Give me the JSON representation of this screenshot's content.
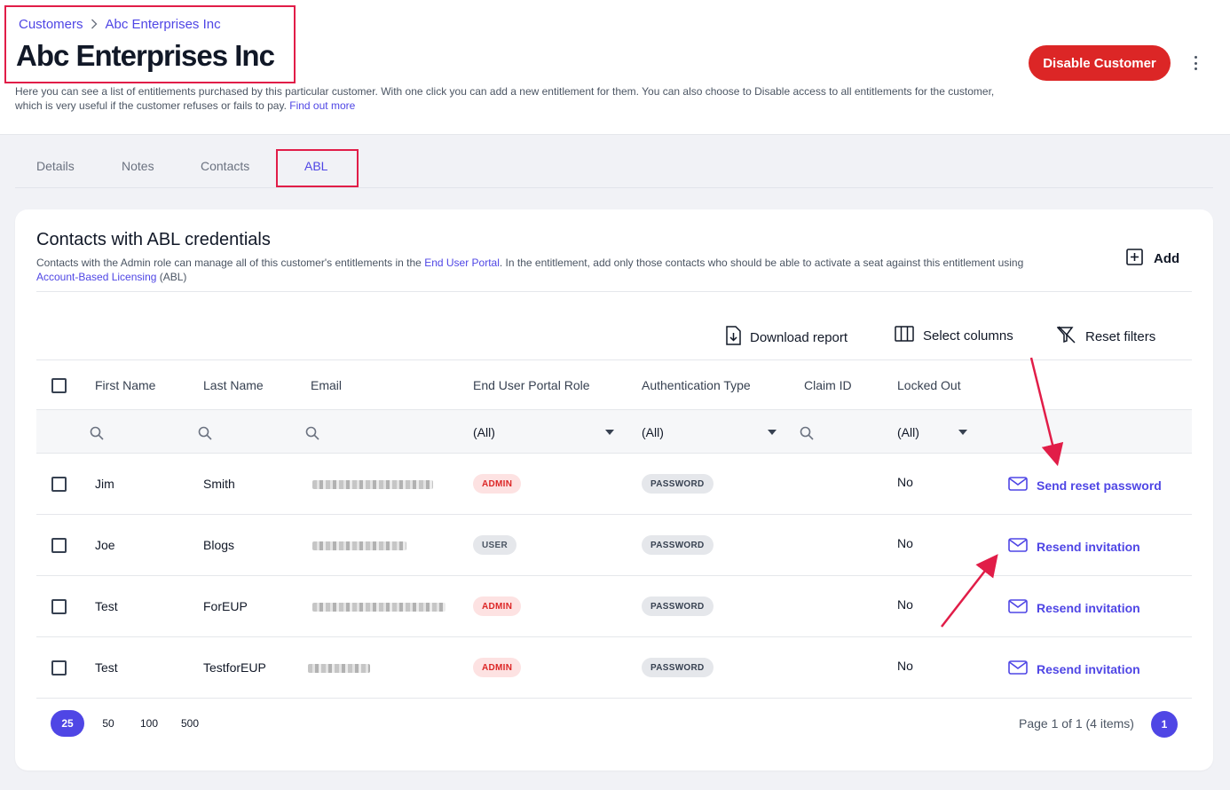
{
  "breadcrumb": {
    "parent": "Customers",
    "current": "Abc Enterprises Inc"
  },
  "page": {
    "title": "Abc Enterprises Inc",
    "description": "Here you can see a list of entitlements purchased by this particular customer. With one click you can add a new entitlement for them. You can also choose to Disable access to all entitlements for the customer, which is very useful if the customer refuses or fails to pay.",
    "find_out_more": "Find out more",
    "disable_button": "Disable Customer"
  },
  "tabs": [
    {
      "label": "Details"
    },
    {
      "label": "Notes"
    },
    {
      "label": "Contacts"
    },
    {
      "label": "ABL"
    }
  ],
  "card": {
    "title": "Contacts with ABL credentials",
    "desc_part1": "Contacts with the Admin role can manage all of this customer's entitlements in the ",
    "desc_link1": "End User Portal",
    "desc_part2": ". In the entitlement, add only those contacts who should be able to activate a seat against this entitlement using ",
    "desc_link2": "Account-Based Licensing",
    "desc_part3": " (ABL)",
    "add_label": "Add"
  },
  "toolbar": {
    "download": "Download report",
    "select_columns": "Select columns",
    "reset_filters": "Reset filters"
  },
  "table": {
    "headers": [
      "First Name",
      "Last Name",
      "Email",
      "End User Portal Role",
      "Authentication Type",
      "Claim ID",
      "Locked Out"
    ],
    "filters": {
      "role": "(All)",
      "auth": "(All)",
      "locked": "(All)"
    },
    "rows": [
      {
        "first": "Jim",
        "last": "Smith",
        "role": "ADMIN",
        "auth": "PASSWORD",
        "locked": "No",
        "action": "Send reset password"
      },
      {
        "first": "Joe",
        "last": "Blogs",
        "role": "USER",
        "auth": "PASSWORD",
        "locked": "No",
        "action": "Resend invitation"
      },
      {
        "first": "Test",
        "last": "ForEUP",
        "role": "ADMIN",
        "auth": "PASSWORD",
        "locked": "No",
        "action": "Resend invitation"
      },
      {
        "first": "Test",
        "last": "TestforEUP",
        "role": "ADMIN",
        "auth": "PASSWORD",
        "locked": "No",
        "action": "Resend invitation"
      }
    ]
  },
  "pagination": {
    "sizes": [
      "25",
      "50",
      "100",
      "500"
    ],
    "info": "Page 1 of 1 (4 items)",
    "current_page": "1"
  },
  "colors": {
    "accent": "#4f46e5",
    "danger": "#dc2626",
    "annotation": "#e11d48"
  }
}
